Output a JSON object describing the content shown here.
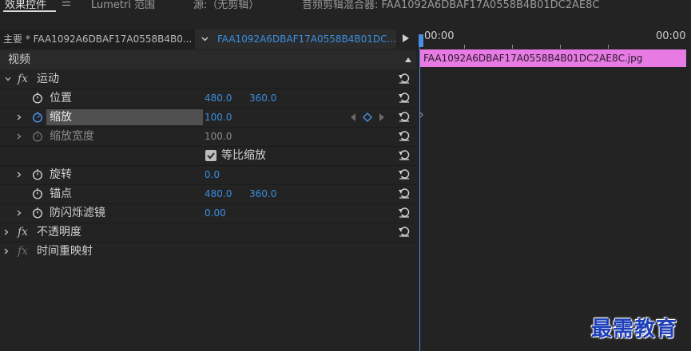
{
  "tabs": [
    {
      "label": "效果控件",
      "active": true
    },
    {
      "label": "Lumetri 范围",
      "active": false
    },
    {
      "label": "源:（无剪辑）",
      "active": false
    },
    {
      "label": "音频剪辑混合器: FAA1092A6DBAF17A0558B4B01DC2AE8C",
      "active": false
    }
  ],
  "header": {
    "master_label": "主要 * FAA1092A6DBAF17A0558B4B0...",
    "clip_label": "FAA1092A6DBAF17A0558B4B01DC..."
  },
  "sections": {
    "video": "视频",
    "motion": "运动",
    "opacity": "不透明度",
    "time_remap": "时间重映射"
  },
  "properties": {
    "position": {
      "label": "位置",
      "x": "480.0",
      "y": "360.0"
    },
    "scale": {
      "label": "缩放",
      "value": "100.0"
    },
    "scale_width": {
      "label": "缩放宽度",
      "value": "100.0"
    },
    "uniform_scale": {
      "label": "等比缩放",
      "checked": true
    },
    "rotation": {
      "label": "旋转",
      "value": "0.0"
    },
    "anchor": {
      "label": "锚点",
      "x": "480.0",
      "y": "360.0"
    },
    "anti_flicker": {
      "label": "防闪烁滤镜",
      "value": "0.00"
    }
  },
  "fx_symbol": "fx",
  "timeline": {
    "tc_start": "00:00",
    "tc_end": "00:00",
    "clip_name": "FAA1092A6DBAF17A0558B4B01DC2AE8C.jpg"
  },
  "watermark": "最需教育",
  "colors": {
    "accent_blue": "#3b8ee0",
    "clip_pink": "#e77be3",
    "bg": "#232323"
  },
  "icons": [
    "menu-icon",
    "chevron-down-icon",
    "play-icon",
    "chevron-right-icon",
    "stopwatch-icon",
    "reset-icon",
    "keyframe-diamond-icon",
    "checkbox-icon",
    "chevron-up-icon"
  ]
}
